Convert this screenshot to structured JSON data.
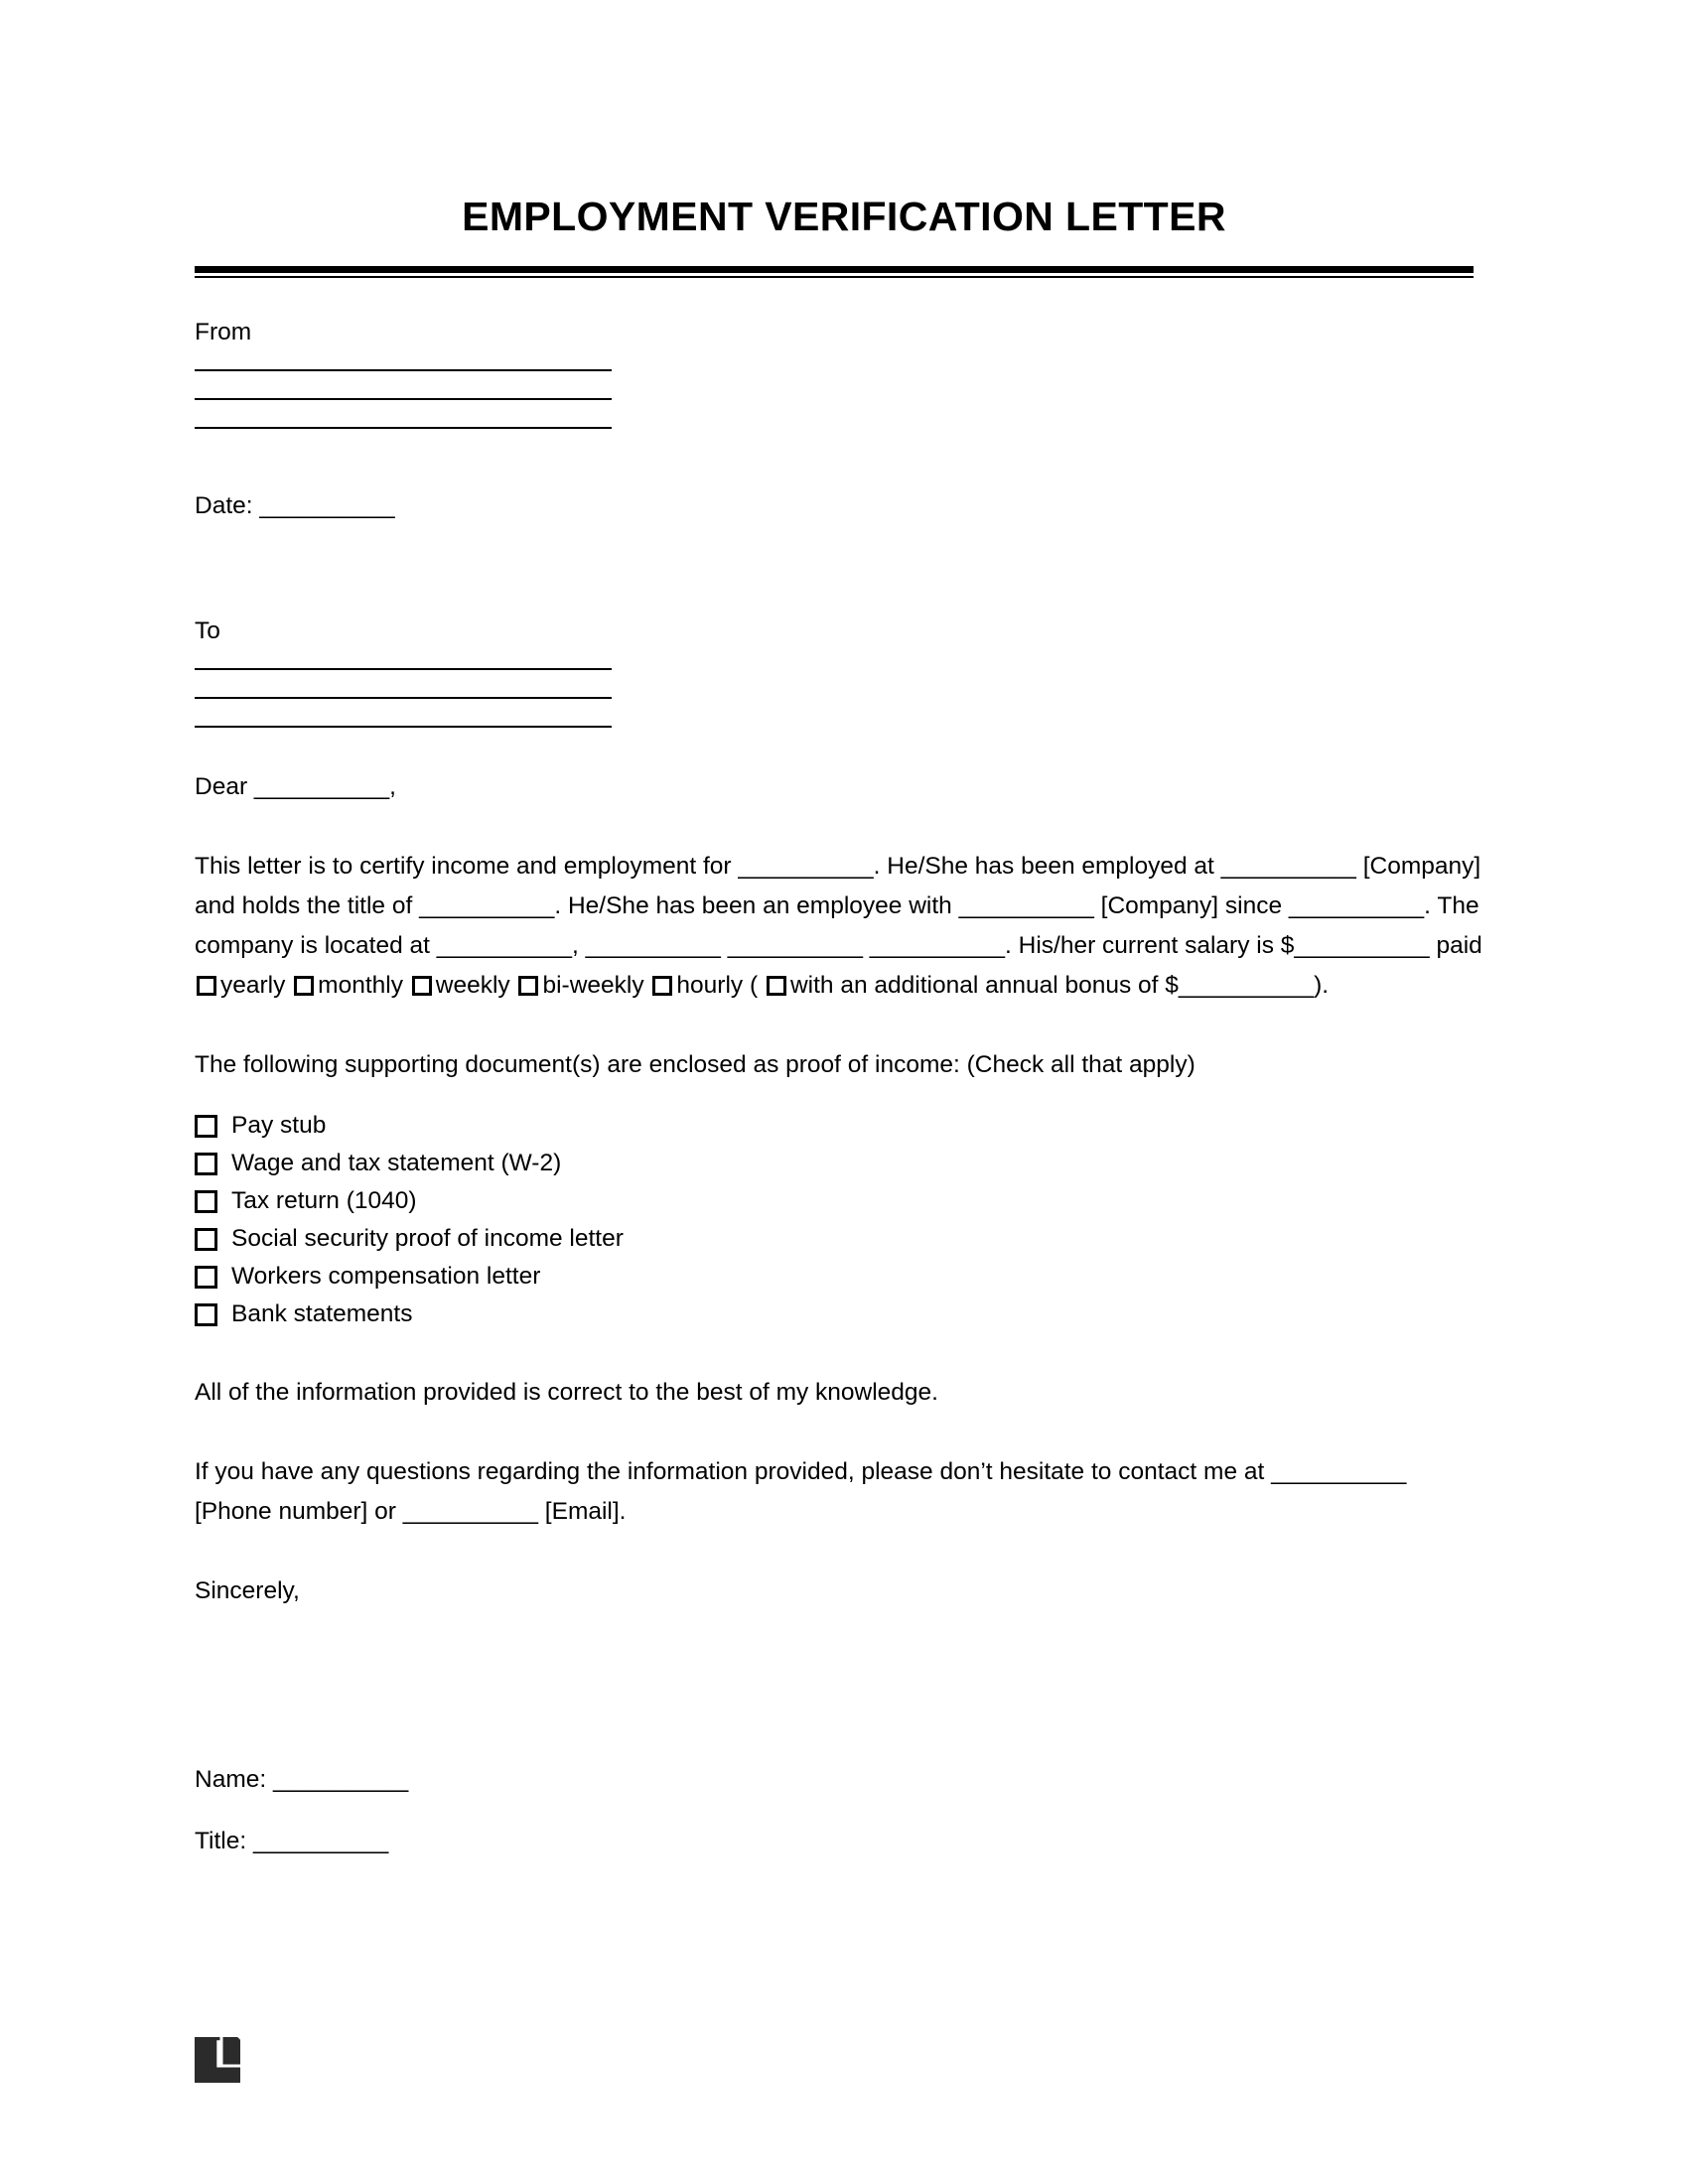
{
  "document": {
    "title": "EMPLOYMENT VERIFICATION LETTER",
    "blank": "__________",
    "blank_short": "_________"
  },
  "from_block": {
    "label": "From",
    "lines": [
      "",
      "",
      ""
    ]
  },
  "date_block": {
    "text": "Date: __________"
  },
  "to_block": {
    "label": "To",
    "lines": [
      "",
      "",
      ""
    ]
  },
  "salutation": {
    "text": "Dear __________,"
  },
  "body": {
    "paragraph_1": {
      "part_1": "This letter is to certify income and employment for __________. He/She has been employed at __________ [Company] and holds the title of __________. He/She has been an employee with __________ [Company] since __________. The company is located at __________, __________ __________ __________. His/her current salary is $__________ paid ",
      "opt_yearly": "yearly",
      "opt_monthly": "monthly",
      "opt_weekly": "weekly",
      "opt_biweekly": "bi-weekly",
      "opt_hourly": "hourly (",
      "bonus_text": "with an additional annual bonus of $__________)."
    },
    "documents_intro": "The following supporting document(s) are enclosed as proof of income: (Check all that apply)",
    "documents": [
      "Pay stub",
      "Wage and tax statement (W-2)",
      "Tax return (1040)",
      "Social security proof of income letter",
      "Workers compensation letter",
      "Bank statements"
    ],
    "accuracy_statement": "All of the information provided is correct to the best of my knowledge.",
    "contact_statement": "If you have any questions regarding the information provided, please don’t hesitate to contact me at __________ [Phone number] or __________ [Email].",
    "closing": "Sincerely,"
  },
  "signature_block": {
    "name": "Name: __________",
    "title": "Title: __________"
  },
  "footer": {
    "logo_name": "legal-templates-logo",
    "logo_color": "#2b2b2b"
  },
  "colors": {
    "text": "#000000",
    "background": "#ffffff",
    "rule": "#000000"
  }
}
